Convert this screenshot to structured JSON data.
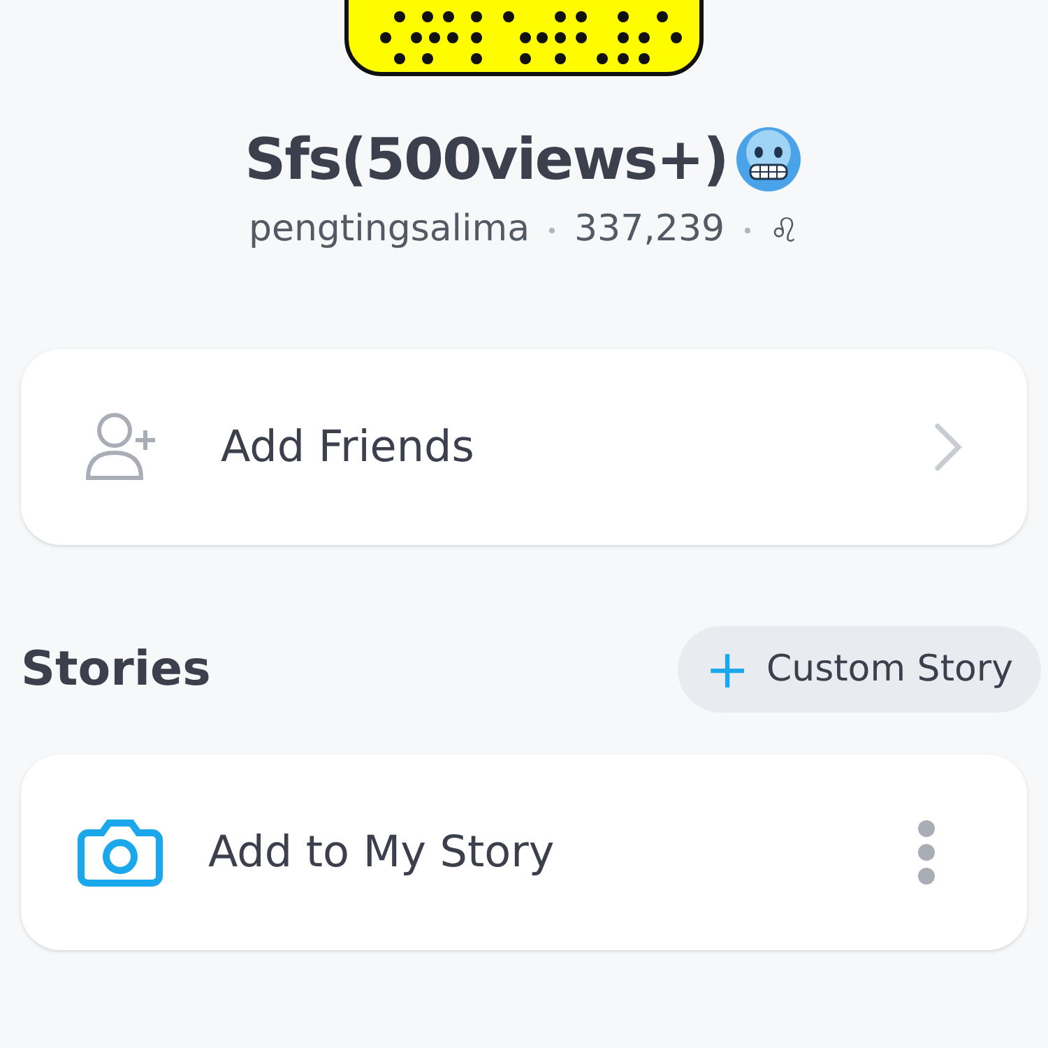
{
  "profile": {
    "display_name": "Sfs(500views+)",
    "username": "pengtingsalima",
    "score": "337,239",
    "zodiac": "♌"
  },
  "add_friends": {
    "label": "Add Friends"
  },
  "stories": {
    "heading": "Stories",
    "custom_story_button": {
      "icon": "+",
      "label": "Custom Story"
    },
    "items": [
      {
        "label": "Add to My Story"
      }
    ]
  }
}
